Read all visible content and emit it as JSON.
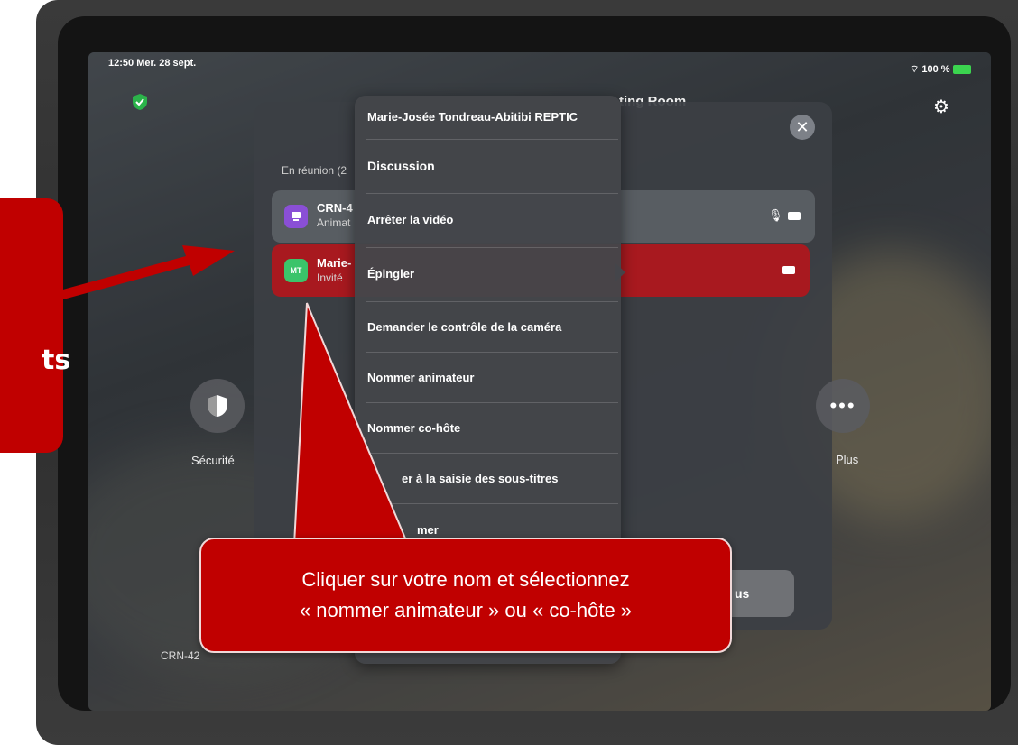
{
  "status_bar": {
    "time_date": "12:50  Mer. 28 sept.",
    "battery": "100 %"
  },
  "header": {
    "title_partial": "ting Room"
  },
  "participants": {
    "section_label": "En réunion (2",
    "rows": [
      {
        "avatar_text": "",
        "name": "CRN-4",
        "role": "Animat",
        "avatar_color": "#8a4fd6"
      },
      {
        "avatar_text": "MT",
        "name": "Marie-",
        "role": "Invité",
        "avatar_color": "#3bc46a"
      }
    ]
  },
  "context_menu": {
    "title": "Marie-Josée Tondreau-Abitibi REPTIC",
    "items": [
      "Discussion",
      "Arrêter la vidéo",
      "Épingler",
      "Demander le contrôle de la caméra",
      "Nommer animateur",
      "Nommer co-hôte",
      "er à la saisie des sous-titres",
      "mer"
    ]
  },
  "side_buttons": {
    "security_label": "Sécurité",
    "more_label": "Plus",
    "more_glyph": "•••"
  },
  "bottom": {
    "room_partial": "CRN-42",
    "button_partial": "us"
  },
  "callouts": {
    "left_partial": "ts",
    "main_line1": "Cliquer sur votre nom et sélectionnez",
    "main_line2": "« nommer animateur » ou « co-hôte »"
  },
  "colors": {
    "callout_red": "#c00000",
    "highlight_row": "#a8191f",
    "shield_green": "#2bb34a"
  }
}
